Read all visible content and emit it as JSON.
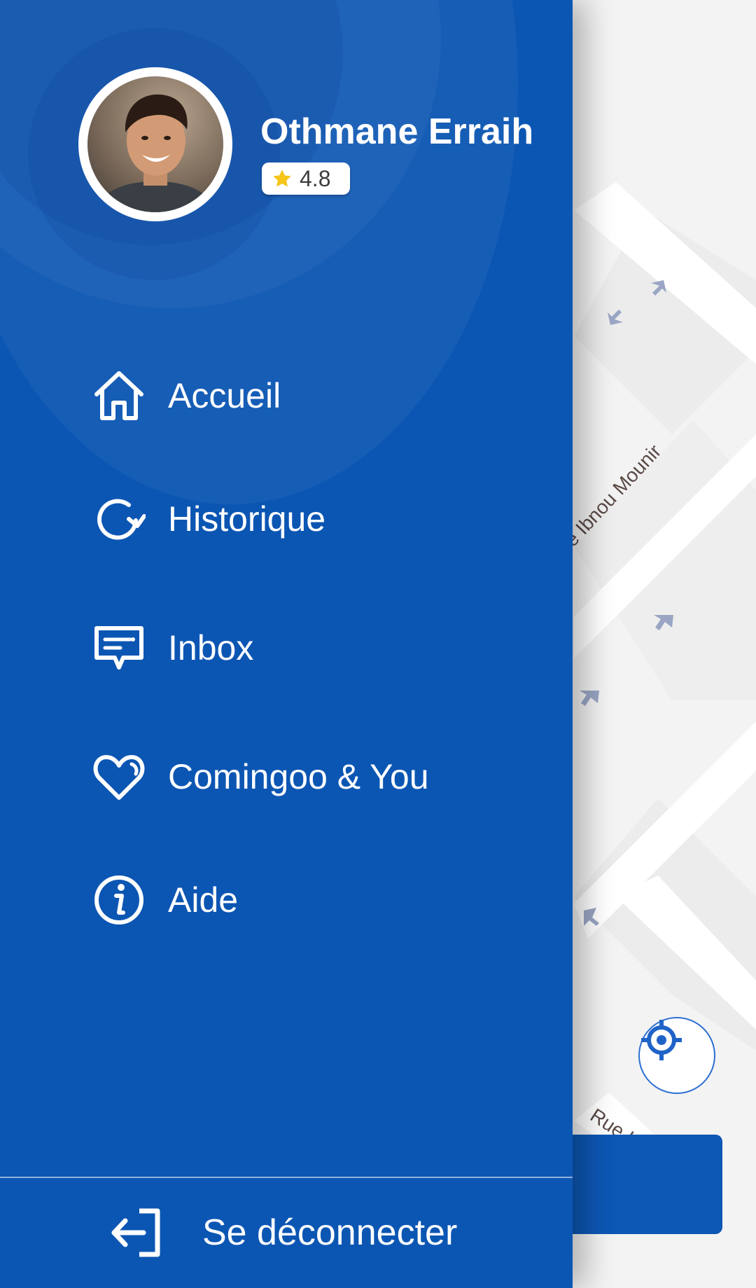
{
  "user": {
    "name": "Othmane Erraih",
    "rating": "4.8"
  },
  "menu": {
    "items": [
      {
        "label": "Accueil",
        "icon": "home-icon"
      },
      {
        "label": "Historique",
        "icon": "history-icon"
      },
      {
        "label": "Inbox",
        "icon": "inbox-icon"
      },
      {
        "label": "Comingoo & You",
        "icon": "heart-icon"
      },
      {
        "label": "Aide",
        "icon": "info-icon"
      }
    ],
    "logout_label": "Se déconnecter"
  },
  "map": {
    "street_1": "e Ibnou Mounir",
    "street_2": "Rue I",
    "locate_icon": "locate-icon"
  },
  "colors": {
    "drawer": "#0c56b3",
    "accent": "#2c6fd1",
    "star": "#f5c518"
  }
}
